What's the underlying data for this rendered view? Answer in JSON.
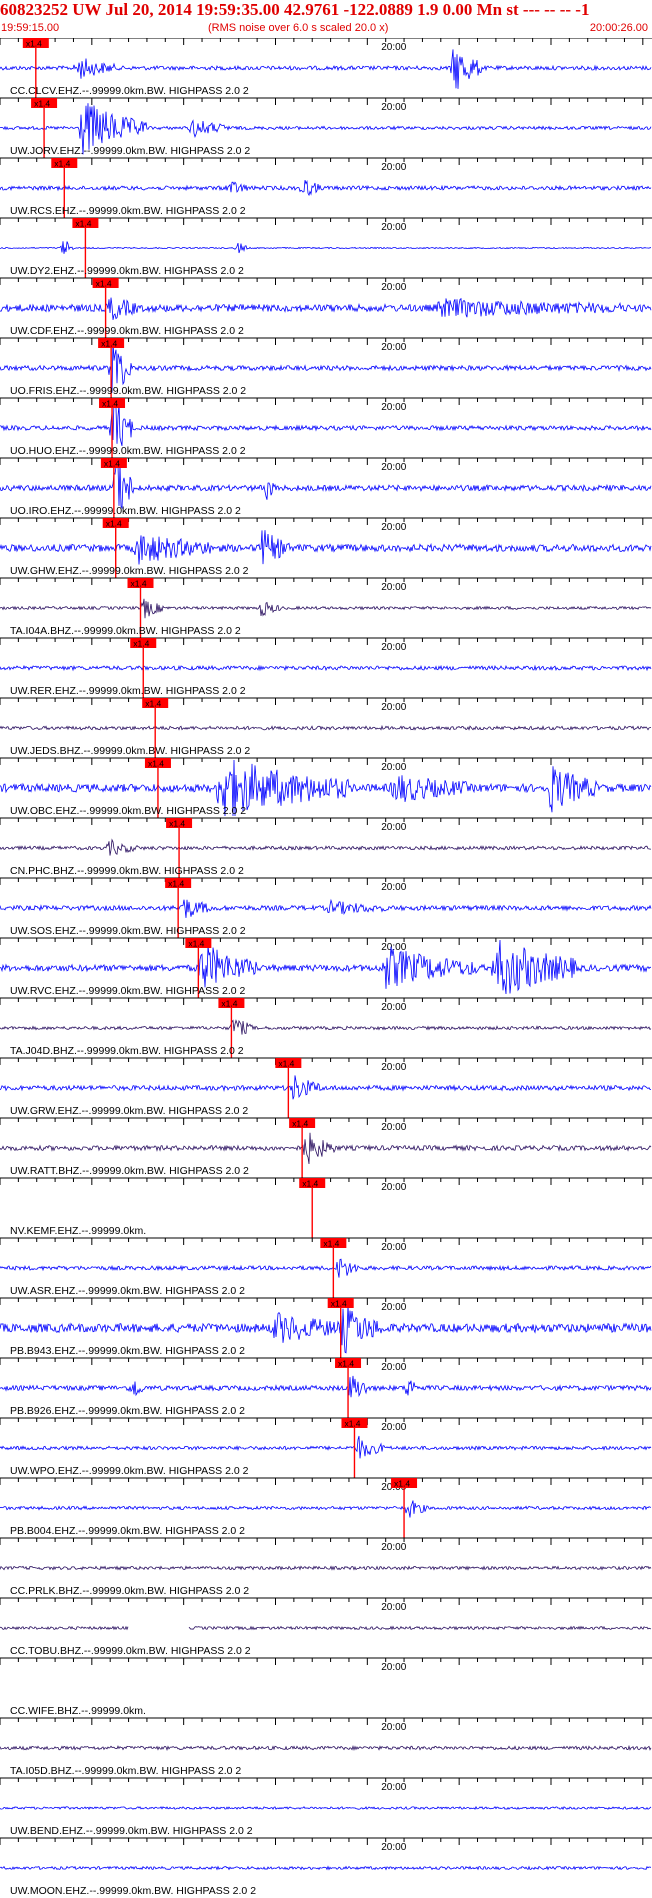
{
  "header": {
    "title": "60823252 UW Jul 20, 2014 19:59:35.00   42.9761 -122.0889  1.9 0.00 Mn st --- -- --  -1",
    "start_time": "19:59:15.00",
    "noise_note": "(RMS noise over 6.0 s scaled 20.0 x)",
    "end_time": "20:00:26.00"
  },
  "pick_label": "x1.4",
  "minute_label": "20:00",
  "colors": {
    "blue_trace": "#0000ff",
    "dark_trace": "#2a1060",
    "pick": "#ff0000",
    "text": "#000000",
    "header_text": "#e00000"
  },
  "chart_data": {
    "type": "seismogram",
    "title": "60823252 UW Jul 20, 2014 19:59:35.00   42.9761 -122.0889  1.9 0.00 Mn st --- -- --  -1",
    "time_start": "19:59:15.00",
    "time_end": "20:00:26.00",
    "series": [
      {
        "label": "CC.CLCV.EHZ.--.99999.0km.BW. HIGHPASS  2.0  2",
        "pick_time": 3.9,
        "trace_color": "blue",
        "noise": 0.25,
        "bursts": [
          {
            "t": 8.5,
            "amp": 1.4,
            "dur": 4
          },
          {
            "t": 49.5,
            "amp": 3.2,
            "dur": 3
          }
        ]
      },
      {
        "label": "UW.JORV.EHZ.--.99999.0km.BW. HIGHPASS  2.0  2",
        "pick_time": 4.8,
        "trace_color": "blue",
        "noise": 0.2,
        "bursts": [
          {
            "t": 9.0,
            "amp": 3.6,
            "dur": 7
          },
          {
            "t": 21.0,
            "amp": 1.1,
            "dur": 4
          }
        ]
      },
      {
        "label": "UW.RCS.EHZ.--.99999.0km.BW. HIGHPASS  2.0  2",
        "pick_time": 7.0,
        "trace_color": "blue",
        "noise": 0.25,
        "bursts": [
          {
            "t": 25.0,
            "amp": 0.9,
            "dur": 2
          },
          {
            "t": 33.0,
            "amp": 1.2,
            "dur": 2
          }
        ]
      },
      {
        "label": "UW.DY2.EHZ.--.99999.0km.BW. HIGHPASS  2.0  2",
        "pick_time": 9.3,
        "trace_color": "blue",
        "noise": 0.08,
        "bursts": [
          {
            "t": 7.0,
            "amp": 1.3,
            "dur": 1
          },
          {
            "t": 26.0,
            "amp": 0.8,
            "dur": 1
          }
        ]
      },
      {
        "label": "UW.CDF.EHZ.--.99999.0km.BW. HIGHPASS  2.0  2",
        "pick_time": 11.5,
        "trace_color": "blue",
        "noise": 0.45,
        "bursts": [
          {
            "t": 12.0,
            "amp": 1.4,
            "dur": 3
          },
          {
            "t": 48.0,
            "amp": 0.9,
            "dur": 20
          }
        ]
      },
      {
        "label": "UO.FRIS.EHZ.--.99999.0km.BW. HIGHPASS  2.0  2",
        "pick_time": 12.1,
        "trace_color": "blue",
        "noise": 0.3,
        "bursts": [
          {
            "t": 12.3,
            "amp": 4.5,
            "dur": 2
          }
        ]
      },
      {
        "label": "UO.HUO.EHZ.--.99999.0km.BW. HIGHPASS  2.0  2",
        "pick_time": 12.2,
        "trace_color": "blue",
        "noise": 0.28,
        "bursts": [
          {
            "t": 12.4,
            "amp": 4.5,
            "dur": 2
          }
        ]
      },
      {
        "label": "UO.IRO.EHZ.--.99999.0km.BW. HIGHPASS  2.0  2",
        "pick_time": 12.4,
        "trace_color": "blue",
        "noise": 0.35,
        "bursts": [
          {
            "t": 12.6,
            "amp": 4.5,
            "dur": 2
          },
          {
            "t": 29.0,
            "amp": 1.5,
            "dur": 1
          }
        ]
      },
      {
        "label": "UW.GHW.EHZ.--.99999.0km.BW. HIGHPASS  2.0  2",
        "pick_time": 12.6,
        "trace_color": "blue",
        "noise": 0.45,
        "bursts": [
          {
            "t": 15.0,
            "amp": 1.8,
            "dur": 8
          },
          {
            "t": 28.5,
            "amp": 2.2,
            "dur": 3
          }
        ]
      },
      {
        "label": "TA.I04A.BHZ.--.99999.0km.BW. HIGHPASS  2.0  2",
        "pick_time": 15.3,
        "trace_color": "dark",
        "noise": 0.18,
        "bursts": [
          {
            "t": 15.8,
            "amp": 1.3,
            "dur": 2
          },
          {
            "t": 28.5,
            "amp": 1.0,
            "dur": 2
          }
        ]
      },
      {
        "label": "UW.RER.EHZ.--.99999.0km.BW. HIGHPASS  2.0  2",
        "pick_time": 15.6,
        "trace_color": "blue",
        "noise": 0.25,
        "bursts": []
      },
      {
        "label": "UW.JEDS.BHZ.--.99999.0km.BW. HIGHPASS  2.0  2",
        "pick_time": 16.9,
        "trace_color": "dark",
        "noise": 0.22,
        "bursts": []
      },
      {
        "label": "UW.OBC.EHZ.--.99999.0km.BW. HIGHPASS  2.0  2",
        "pick_time": 17.2,
        "trace_color": "blue",
        "noise": 0.5,
        "bursts": [
          {
            "t": 24.0,
            "amp": 3.8,
            "dur": 14
          },
          {
            "t": 43.0,
            "amp": 1.6,
            "dur": 8
          },
          {
            "t": 60.0,
            "amp": 2.8,
            "dur": 5
          }
        ]
      },
      {
        "label": "CN.PHC.BHZ.--.99999.0km.BW. HIGHPASS  2.0  2",
        "pick_time": 19.5,
        "trace_color": "dark",
        "noise": 0.22,
        "bursts": [
          {
            "t": 12.0,
            "amp": 0.9,
            "dur": 3
          }
        ]
      },
      {
        "label": "UW.SOS.EHZ.--.99999.0km.BW. HIGHPASS  2.0  2",
        "pick_time": 19.4,
        "trace_color": "blue",
        "noise": 0.3,
        "bursts": [
          {
            "t": 20.0,
            "amp": 1.3,
            "dur": 3
          },
          {
            "t": 36.0,
            "amp": 0.7,
            "dur": 6
          }
        ]
      },
      {
        "label": "UW.RVC.EHZ.--.99999.0km.BW. HIGHPASS  2.0  2",
        "pick_time": 21.6,
        "trace_color": "blue",
        "noise": 0.4,
        "bursts": [
          {
            "t": 22.0,
            "amp": 3.0,
            "dur": 6
          },
          {
            "t": 42.0,
            "amp": 2.5,
            "dur": 10
          },
          {
            "t": 54.0,
            "amp": 4.0,
            "dur": 9
          }
        ]
      },
      {
        "label": "TA.J04D.BHZ.--.99999.0km.BW. HIGHPASS  2.0  2",
        "pick_time": 25.2,
        "trace_color": "dark",
        "noise": 0.2,
        "bursts": [
          {
            "t": 25.5,
            "amp": 1.5,
            "dur": 2
          }
        ]
      },
      {
        "label": "UW.GRW.EHZ.--.99999.0km.BW. HIGHPASS  2.0  2",
        "pick_time": 31.4,
        "trace_color": "blue",
        "noise": 0.3,
        "bursts": [
          {
            "t": 32.0,
            "amp": 1.6,
            "dur": 3
          }
        ]
      },
      {
        "label": "UW.RATT.BHZ.--.99999.0km.BW. HIGHPASS  2.0  2",
        "pick_time": 32.9,
        "trace_color": "dark",
        "noise": 0.3,
        "bursts": [
          {
            "t": 33.4,
            "amp": 2.0,
            "dur": 3
          }
        ]
      },
      {
        "label": "NV.KEMF.EHZ.--.99999.0km.",
        "pick_time": 34.0,
        "trace_color": "none",
        "noise": 0,
        "bursts": []
      },
      {
        "label": "UW.ASR.EHZ.--.99999.0km.BW. HIGHPASS  2.0  2",
        "pick_time": 36.3,
        "trace_color": "blue",
        "noise": 0.25,
        "bursts": [
          {
            "t": 37.0,
            "amp": 1.5,
            "dur": 2
          }
        ]
      },
      {
        "label": "PB.B943.EHZ.--.99999.0km.BW. HIGHPASS  2.0  2",
        "pick_time": 37.1,
        "trace_color": "blue",
        "noise": 0.55,
        "bursts": [
          {
            "t": 30.0,
            "amp": 1.6,
            "dur": 8
          },
          {
            "t": 37.5,
            "amp": 2.6,
            "dur": 4
          }
        ]
      },
      {
        "label": "PB.B926.EHZ.--.99999.0km.BW. HIGHPASS  2.0  2",
        "pick_time": 37.9,
        "trace_color": "blue",
        "noise": 0.3,
        "bursts": [
          {
            "t": 38.3,
            "amp": 1.8,
            "dur": 2
          },
          {
            "t": 14.5,
            "amp": 1.6,
            "dur": 1
          },
          {
            "t": 44.5,
            "amp": 1.5,
            "dur": 1
          }
        ]
      },
      {
        "label": "UW.WPO.EHZ.--.99999.0km.BW. HIGHPASS  2.0  2",
        "pick_time": 38.6,
        "trace_color": "blue",
        "noise": 0.22,
        "bursts": [
          {
            "t": 39.0,
            "amp": 1.4,
            "dur": 3
          }
        ]
      },
      {
        "label": "PB.B004.EHZ.--.99999.0km.BW. HIGHPASS  2.0  2",
        "pick_time": 44.0,
        "trace_color": "blue",
        "noise": 0.2,
        "bursts": [
          {
            "t": 44.5,
            "amp": 1.2,
            "dur": 2
          }
        ]
      },
      {
        "label": "CC.PRLK.BHZ.--.99999.0km.BW. HIGHPASS  2.0  2",
        "pick_time": null,
        "trace_color": "dark",
        "noise": 0.2,
        "bursts": []
      },
      {
        "label": "CC.TOBU.BHZ.--.99999.0km.BW. HIGHPASS  2.0  2",
        "pick_time": null,
        "trace_color": "dark",
        "noise": 0.18,
        "bursts": [],
        "gap": [
          14.0,
          20.5
        ]
      },
      {
        "label": "CC.WIFE.BHZ.--.99999.0km.",
        "pick_time": null,
        "trace_color": "none",
        "noise": 0,
        "bursts": []
      },
      {
        "label": "TA.I05D.BHZ.--.99999.0km.BW. HIGHPASS  2.0  2",
        "pick_time": null,
        "trace_color": "dark",
        "noise": 0.22,
        "bursts": []
      },
      {
        "label": "UW.BEND.EHZ.--.99999.0km.BW. HIGHPASS  2.0  2",
        "pick_time": null,
        "trace_color": "blue",
        "noise": 0.15,
        "bursts": []
      },
      {
        "label": "UW.MOON.EHZ.--.99999.0km.BW. HIGHPASS  2.0  2",
        "pick_time": null,
        "trace_color": "blue",
        "noise": 0.18,
        "bursts": []
      }
    ]
  }
}
